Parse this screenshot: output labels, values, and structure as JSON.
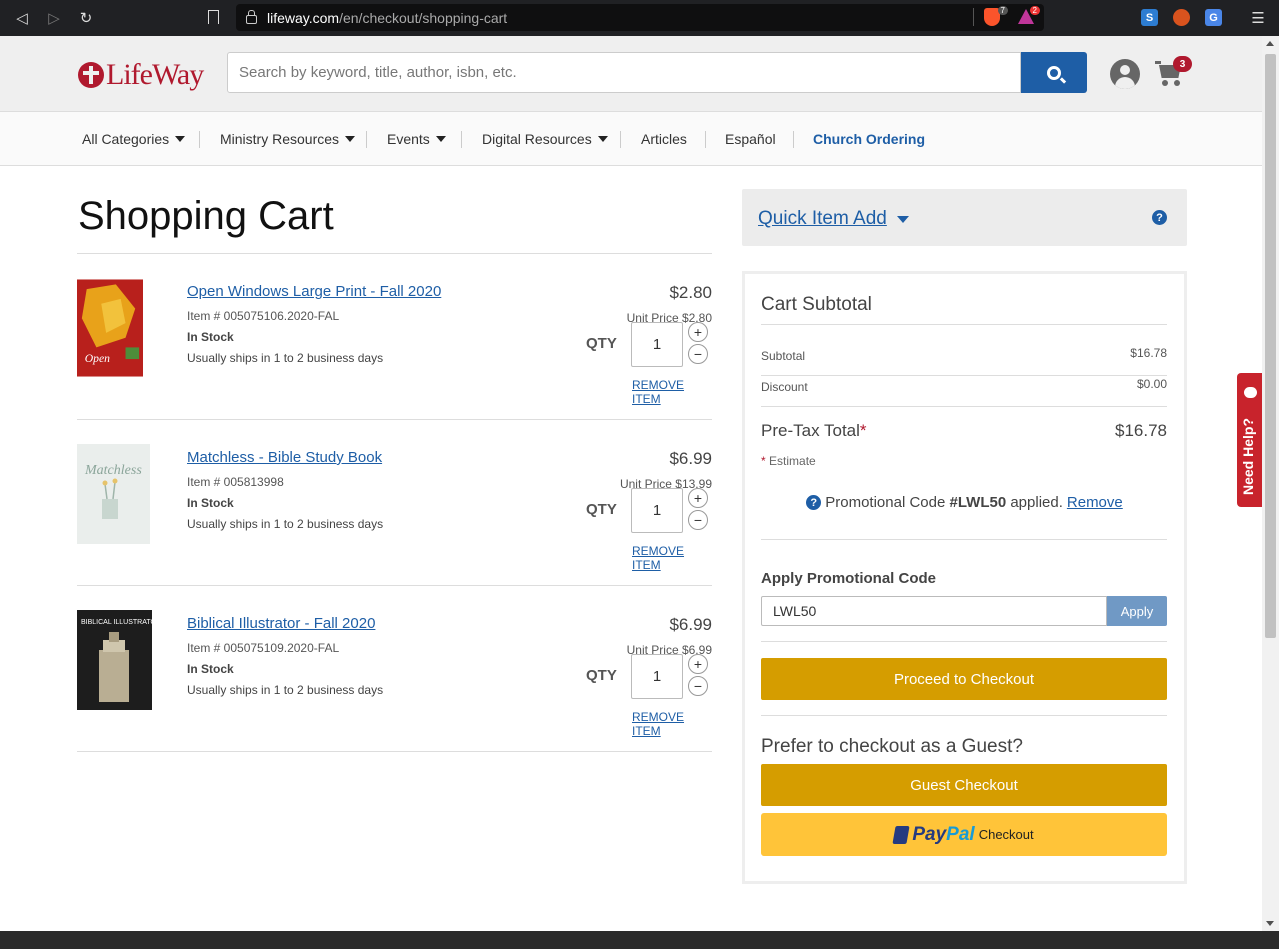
{
  "browser": {
    "url_host": "lifeway.com",
    "url_path": "/en/checkout/shopping-cart",
    "brave_shields_count": "7",
    "rewards_count": "2"
  },
  "header": {
    "logo_text": "LifeWay",
    "search_placeholder": "Search by keyword, title, author, isbn, etc.",
    "cart_count": "3"
  },
  "nav": {
    "items": [
      {
        "label": "All Categories",
        "dropdown": true
      },
      {
        "label": "Ministry Resources",
        "dropdown": true
      },
      {
        "label": "Events",
        "dropdown": true
      },
      {
        "label": "Digital Resources",
        "dropdown": true
      },
      {
        "label": "Articles",
        "dropdown": false
      },
      {
        "label": "Español",
        "dropdown": false
      },
      {
        "label": "Church Ordering",
        "dropdown": false
      }
    ]
  },
  "cart": {
    "title": "Shopping Cart",
    "qty_label": "QTY",
    "remove_label": "REMOVE ITEM",
    "items": [
      {
        "title": "Open Windows Large Print - Fall 2020",
        "item_num": "Item # 005075106.2020-FAL",
        "stock": "In Stock",
        "shipping": "Usually ships in 1 to 2 business days",
        "price": "$2.80",
        "unit_price": "Unit Price $2.80",
        "qty": "1"
      },
      {
        "title": "Matchless - Bible Study Book",
        "item_num": "Item # 005813998",
        "stock": "In Stock",
        "shipping": "Usually ships in 1 to 2 business days",
        "price": "$6.99",
        "unit_price": "Unit Price $13.99",
        "qty": "1"
      },
      {
        "title": "Biblical Illustrator - Fall 2020",
        "item_num": "Item # 005075109.2020-FAL",
        "stock": "In Stock",
        "shipping": "Usually ships in 1 to 2 business days",
        "price": "$6.99",
        "unit_price": "Unit Price $6.99",
        "qty": "1"
      }
    ]
  },
  "quick_add": {
    "label": "Quick Item Add"
  },
  "summary": {
    "title": "Cart Subtotal",
    "subtotal_label": "Subtotal",
    "subtotal_value": "$16.78",
    "discount_label": "Discount",
    "discount_value": "$0.00",
    "pretax_label": "Pre-Tax Total",
    "pretax_value": "$16.78",
    "estimate_label": "Estimate",
    "promo_text_pre": "Promotional Code ",
    "promo_code_applied": "#LWL50",
    "promo_text_post": " applied.",
    "promo_remove": "Remove",
    "apply_promo_label": "Apply Promotional Code",
    "promo_input_value": "LWL50",
    "apply_button": "Apply",
    "checkout_button": "Proceed to Checkout",
    "guest_question": "Prefer to checkout as a Guest?",
    "guest_button": "Guest Checkout",
    "paypal_pay": "Pay",
    "paypal_pal": "Pal",
    "paypal_checkout": "Checkout"
  },
  "need_help": {
    "label": "Need Help?"
  },
  "colors": {
    "brand_red": "#b0192e",
    "link_blue": "#1e5ea6",
    "checkout_gold": "#d59d00",
    "paypal_yellow": "#ffc439"
  }
}
